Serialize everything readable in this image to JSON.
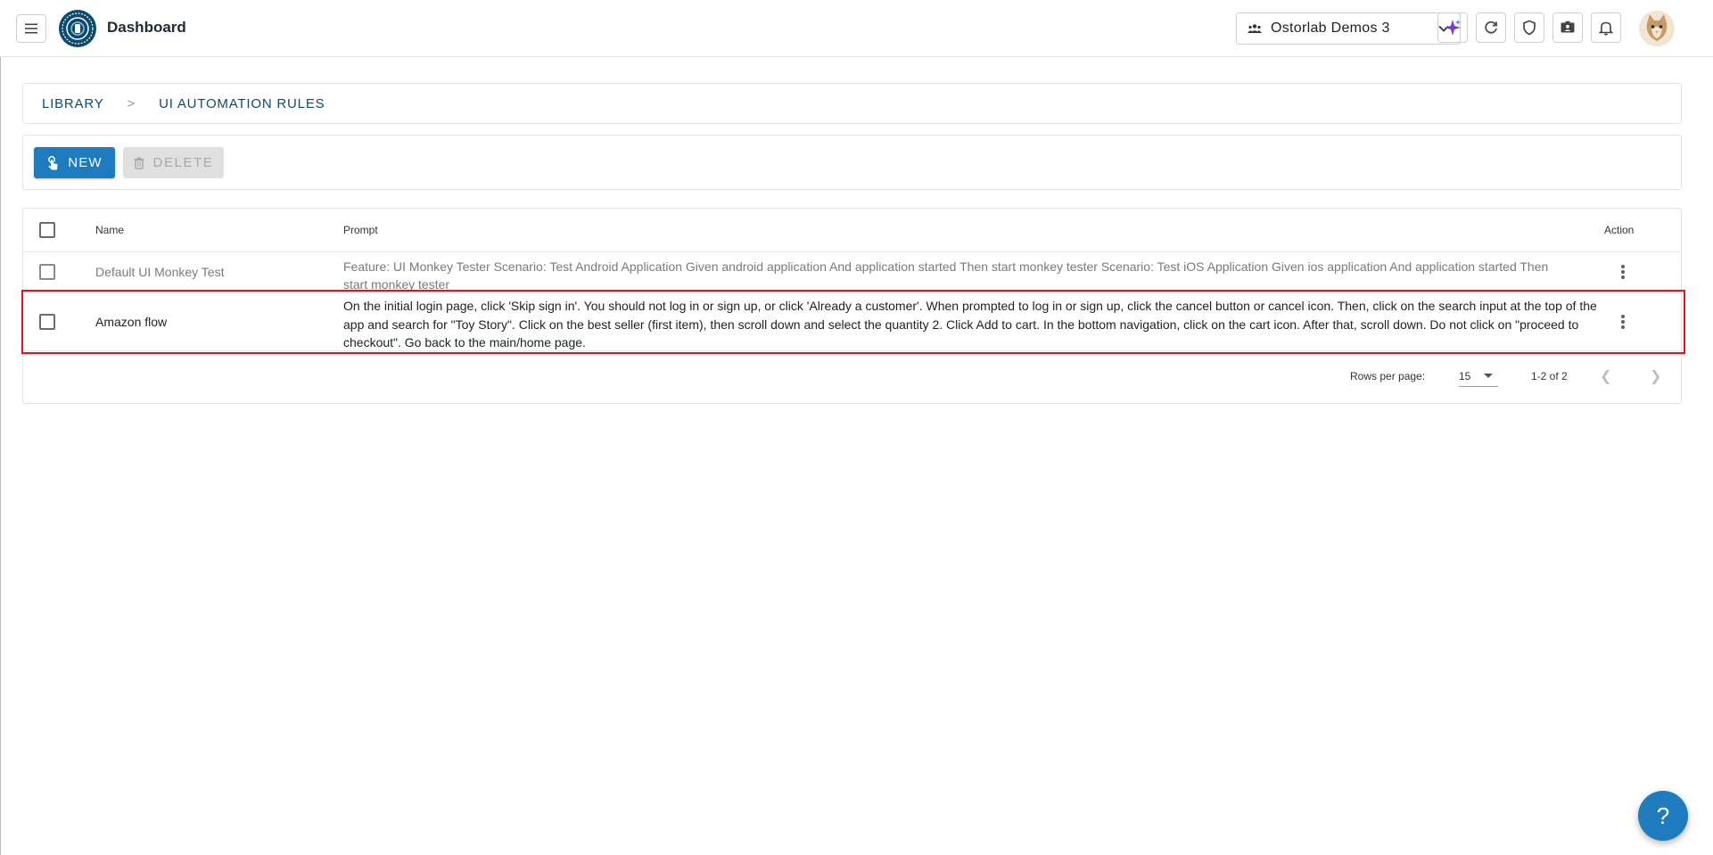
{
  "header": {
    "title": "Dashboard",
    "organization": "Ostorlab Demos 3",
    "icons": [
      "menu-icon",
      "ostorlab-logo",
      "team-icon",
      "chevron-down-icon",
      "sparkle-icon",
      "refresh-icon",
      "shield-icon",
      "id-card-icon",
      "bell-icon",
      "avatar"
    ]
  },
  "breadcrumb": {
    "items": [
      "LIBRARY",
      "UI AUTOMATION RULES"
    ],
    "separator": ">"
  },
  "toolbar": {
    "new_label": "NEW",
    "delete_label": "DELETE"
  },
  "table": {
    "columns": {
      "name": "Name",
      "prompt": "Prompt",
      "action": "Action"
    },
    "rows": [
      {
        "name": "Default UI Monkey Test",
        "prompt": "Feature: UI Monkey Tester Scenario: Test Android Application Given android application And application started Then start monkey tester Scenario: Test iOS Application Given ios application And application started Then start monkey tester"
      },
      {
        "name": "Amazon flow",
        "prompt": "On the initial login page, click 'Skip sign in'. You should not log in or sign up, or click 'Already a customer'. When prompted to log in or sign up, click the cancel button or cancel icon. Then, click on the search input at the top of the app and search for \"Toy Story\". Click on the best seller (first item), then scroll down and select the quantity 2. Click Add to cart. In the bottom navigation, click on the cart icon. After that, scroll down. Do not click on \"proceed to checkout\". Go back to the main/home page."
      }
    ]
  },
  "pagination": {
    "rows_per_page_label": "Rows per page:",
    "rows_per_page": "15",
    "range": "1-2 of 2"
  },
  "help": {
    "label": "?"
  },
  "colors": {
    "primary": "#1e7bbd",
    "brand_dark": "#0c4a6e",
    "highlight": "#e8111d"
  }
}
